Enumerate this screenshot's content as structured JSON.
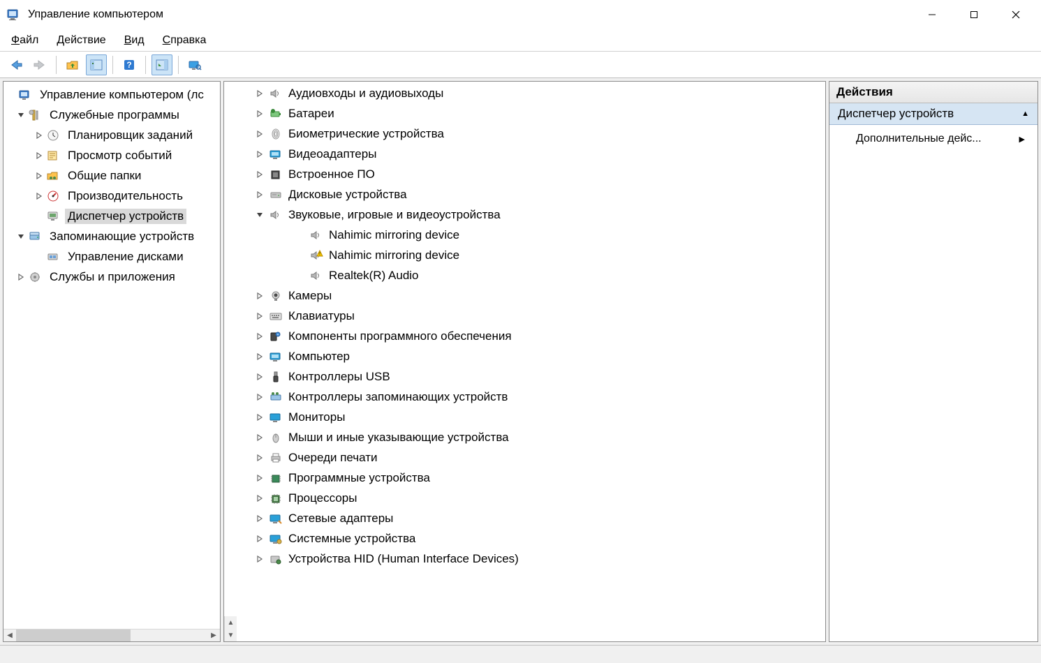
{
  "window": {
    "title": "Управление компьютером"
  },
  "menubar": [
    {
      "hotkey": "Ф",
      "rest": "айл"
    },
    {
      "hotkey": "Д",
      "rest": "ействие"
    },
    {
      "hotkey": "В",
      "rest": "ид"
    },
    {
      "hotkey": "С",
      "rest": "правка"
    }
  ],
  "left_tree": [
    {
      "depth": 0,
      "exp": "",
      "icon": "computer-mgmt-icon",
      "label": "Управление компьютером (лс",
      "selected": false
    },
    {
      "depth": 1,
      "exp": "v",
      "icon": "tools-icon",
      "label": "Служебные программы",
      "selected": false
    },
    {
      "depth": 2,
      "exp": ">",
      "icon": "clock-icon",
      "label": "Планировщик заданий",
      "selected": false
    },
    {
      "depth": 2,
      "exp": ">",
      "icon": "eventlog-icon",
      "label": "Просмотр событий",
      "selected": false
    },
    {
      "depth": 2,
      "exp": ">",
      "icon": "folder-share-icon",
      "label": "Общие папки",
      "selected": false
    },
    {
      "depth": 2,
      "exp": ">",
      "icon": "perf-icon",
      "label": "Производительность",
      "selected": false
    },
    {
      "depth": 2,
      "exp": "",
      "icon": "device-mgr-icon",
      "label": "Диспетчер устройств",
      "selected": true
    },
    {
      "depth": 1,
      "exp": "v",
      "icon": "storage-icon",
      "label": "Запоминающие устройств",
      "selected": false
    },
    {
      "depth": 2,
      "exp": "",
      "icon": "disk-mgmt-icon",
      "label": "Управление дисками",
      "selected": false
    },
    {
      "depth": 1,
      "exp": ">",
      "icon": "services-icon",
      "label": "Службы и приложения",
      "selected": false
    }
  ],
  "devices": [
    {
      "depth": 1,
      "exp": ">",
      "icon": "speaker-icon",
      "label": "Аудиовходы и аудиовыходы",
      "warn": false
    },
    {
      "depth": 1,
      "exp": ">",
      "icon": "battery-icon",
      "label": "Батареи",
      "warn": false
    },
    {
      "depth": 1,
      "exp": ">",
      "icon": "fingerprint-icon",
      "label": "Биометрические устройства",
      "warn": false
    },
    {
      "depth": 1,
      "exp": ">",
      "icon": "display-adapter-icon",
      "label": "Видеоадаптеры",
      "warn": false
    },
    {
      "depth": 1,
      "exp": ">",
      "icon": "firmware-icon",
      "label": "Встроенное ПО",
      "warn": false
    },
    {
      "depth": 1,
      "exp": ">",
      "icon": "drive-icon",
      "label": "Дисковые устройства",
      "warn": false
    },
    {
      "depth": 1,
      "exp": "v",
      "icon": "speaker-icon",
      "label": "Звуковые, игровые и видеоустройства",
      "warn": false
    },
    {
      "depth": 2,
      "exp": "",
      "icon": "speaker-icon",
      "label": "Nahimic mirroring device",
      "warn": false
    },
    {
      "depth": 2,
      "exp": "",
      "icon": "speaker-icon",
      "label": "Nahimic mirroring device",
      "warn": true
    },
    {
      "depth": 2,
      "exp": "",
      "icon": "speaker-icon",
      "label": "Realtek(R) Audio",
      "warn": false
    },
    {
      "depth": 1,
      "exp": ">",
      "icon": "camera-icon",
      "label": "Камеры",
      "warn": false
    },
    {
      "depth": 1,
      "exp": ">",
      "icon": "keyboard-icon",
      "label": "Клавиатуры",
      "warn": false
    },
    {
      "depth": 1,
      "exp": ">",
      "icon": "software-component-icon",
      "label": "Компоненты программного обеспечения",
      "warn": false
    },
    {
      "depth": 1,
      "exp": ">",
      "icon": "computer-icon",
      "label": "Компьютер",
      "warn": false
    },
    {
      "depth": 1,
      "exp": ">",
      "icon": "usb-icon",
      "label": "Контроллеры USB",
      "warn": false
    },
    {
      "depth": 1,
      "exp": ">",
      "icon": "storage-ctrl-icon",
      "label": "Контроллеры запоминающих устройств",
      "warn": false
    },
    {
      "depth": 1,
      "exp": ">",
      "icon": "monitor-icon",
      "label": "Мониторы",
      "warn": false
    },
    {
      "depth": 1,
      "exp": ">",
      "icon": "mouse-icon",
      "label": "Мыши и иные указывающие устройства",
      "warn": false
    },
    {
      "depth": 1,
      "exp": ">",
      "icon": "printer-icon",
      "label": "Очереди печати",
      "warn": false
    },
    {
      "depth": 1,
      "exp": ">",
      "icon": "chip-icon",
      "label": "Программные устройства",
      "warn": false
    },
    {
      "depth": 1,
      "exp": ">",
      "icon": "cpu-icon",
      "label": "Процессоры",
      "warn": false
    },
    {
      "depth": 1,
      "exp": ">",
      "icon": "network-icon",
      "label": "Сетевые адаптеры",
      "warn": false
    },
    {
      "depth": 1,
      "exp": ">",
      "icon": "system-icon",
      "label": "Системные устройства",
      "warn": false
    },
    {
      "depth": 1,
      "exp": ">",
      "icon": "hid-icon",
      "label": "Устройства HID (Human Interface Devices)",
      "warn": false
    }
  ],
  "actions": {
    "header": "Действия",
    "section": "Диспетчер устройств",
    "items": [
      "Дополнительные дейс..."
    ]
  }
}
